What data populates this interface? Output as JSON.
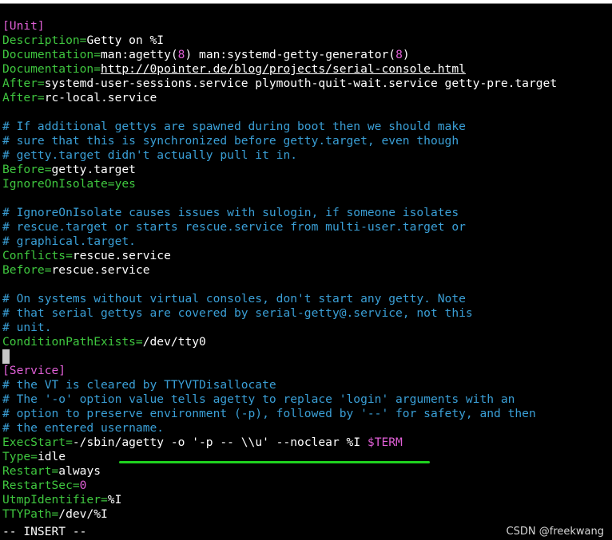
{
  "editor": {
    "lines": [
      [
        {
          "t": "[Unit]",
          "c": "m"
        }
      ],
      [
        {
          "t": "Description=",
          "c": "k"
        },
        {
          "t": "Getty on %I",
          "c": "w"
        }
      ],
      [
        {
          "t": "Documentation=",
          "c": "k"
        },
        {
          "t": "man:agetty(",
          "c": "w"
        },
        {
          "t": "8",
          "c": "n"
        },
        {
          "t": ") man:systemd-getty-generator(",
          "c": "w"
        },
        {
          "t": "8",
          "c": "n"
        },
        {
          "t": ")",
          "c": "w"
        }
      ],
      [
        {
          "t": "Documentation=",
          "c": "k"
        },
        {
          "t": "http://0pointer.de/blog/projects/serial-console.html",
          "c": "w u"
        }
      ],
      [
        {
          "t": "After=",
          "c": "k"
        },
        {
          "t": "systemd-user-sessions.service plymouth-quit-wait.service getty-pre.target",
          "c": "w"
        }
      ],
      [
        {
          "t": "After=",
          "c": "k"
        },
        {
          "t": "rc-local.service",
          "c": "w"
        }
      ],
      [],
      [
        {
          "t": "# If additional gettys are spawned during boot then we should make",
          "c": "c"
        }
      ],
      [
        {
          "t": "# sure that this is synchronized before getty.target, even though",
          "c": "c"
        }
      ],
      [
        {
          "t": "# getty.target didn't actually pull it in.",
          "c": "c"
        }
      ],
      [
        {
          "t": "Before=",
          "c": "k"
        },
        {
          "t": "getty.target",
          "c": "w"
        }
      ],
      [
        {
          "t": "IgnoreOnIsolate=",
          "c": "k"
        },
        {
          "t": "yes",
          "c": "v"
        }
      ],
      [],
      [
        {
          "t": "# IgnoreOnIsolate causes issues with sulogin, if someone isolates",
          "c": "c"
        }
      ],
      [
        {
          "t": "# rescue.target or starts rescue.service from multi-user.target or",
          "c": "c"
        }
      ],
      [
        {
          "t": "# graphical.target.",
          "c": "c"
        }
      ],
      [
        {
          "t": "Conflicts=",
          "c": "k"
        },
        {
          "t": "rescue.service",
          "c": "w"
        }
      ],
      [
        {
          "t": "Before=",
          "c": "k"
        },
        {
          "t": "rescue.service",
          "c": "w"
        }
      ],
      [],
      [
        {
          "t": "# On systems without virtual consoles, don't start any getty. Note",
          "c": "c"
        }
      ],
      [
        {
          "t": "# that serial gettys are covered by serial-getty@.service, not this",
          "c": "c"
        }
      ],
      [
        {
          "t": "# unit.",
          "c": "c"
        }
      ],
      [
        {
          "t": "ConditionPathExists=",
          "c": "k"
        },
        {
          "t": "/dev/tty0",
          "c": "w"
        }
      ],
      [
        {
          "t": "",
          "c": "cursor"
        }
      ],
      [
        {
          "t": "[Service]",
          "c": "m"
        }
      ],
      [
        {
          "t": "# the VT is cleared by TTYVTDisallocate",
          "c": "c"
        }
      ],
      [
        {
          "t": "# The '-o' option value tells agetty to replace 'login' arguments with an",
          "c": "c"
        }
      ],
      [
        {
          "t": "# option to preserve environment (-p), followed by '--' for safety, and then",
          "c": "c"
        }
      ],
      [
        {
          "t": "# the entered username.",
          "c": "c"
        }
      ],
      [
        {
          "t": "ExecStart=",
          "c": "k"
        },
        {
          "t": "-/sbin/agetty -o '-p -- \\\\u' --noclear %I ",
          "c": "w"
        },
        {
          "t": "$TERM",
          "c": "s"
        }
      ],
      [
        {
          "t": "Type=",
          "c": "k"
        },
        {
          "t": "idle",
          "c": "w"
        }
      ],
      [
        {
          "t": "Restart=",
          "c": "k"
        },
        {
          "t": "always",
          "c": "w"
        }
      ],
      [
        {
          "t": "RestartSec=",
          "c": "k"
        },
        {
          "t": "0",
          "c": "n"
        }
      ],
      [
        {
          "t": "UtmpIdentifier=",
          "c": "k"
        },
        {
          "t": "%I",
          "c": "w"
        }
      ],
      [
        {
          "t": "TTYPath=",
          "c": "k"
        },
        {
          "t": "/dev/%I",
          "c": "w"
        }
      ]
    ],
    "mode_status": "-- INSERT --"
  },
  "watermark": "CSDN @freekwang",
  "colors": {
    "background": "#000000",
    "key": "#3fc73f",
    "comment": "#3a9fd6",
    "section": "#e05fd6",
    "highlight_underline": "#1fd21f"
  }
}
